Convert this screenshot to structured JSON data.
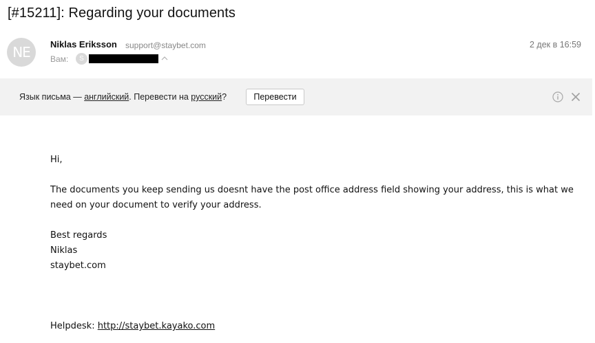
{
  "email": {
    "subject": "[#15211]: Regarding your documents",
    "avatar_initials": "NE",
    "sender_name": "Niklas Eriksson",
    "sender_email": "support@staybet.com",
    "date": "2 дек в 16:59",
    "to_label": "Вам:",
    "to_avatar_initial": "S"
  },
  "translate_bar": {
    "text_prefix": "Язык письма — ",
    "source_language": "английский",
    "text_middle": ". Перевести на ",
    "target_language": "русский",
    "text_suffix": "?",
    "button_label": "Перевести",
    "info_icon": "info-icon",
    "close_icon": "close-icon"
  },
  "body": {
    "greeting": "Hi,",
    "paragraph": "The documents you keep sending us doesnt have the post office address field showing your address, this is what we need on your document to verify your address.",
    "signoff_1": "Best regards",
    "signoff_2": "Niklas",
    "signoff_3": "staybet.com",
    "helpdesk_label": "Helpdesk: ",
    "helpdesk_link": "http://staybet.kayako.com"
  },
  "colors": {
    "translate_bar_bg": "#f2f2f2",
    "avatar_bg": "#d9d9d9",
    "meta_text": "#888888"
  }
}
